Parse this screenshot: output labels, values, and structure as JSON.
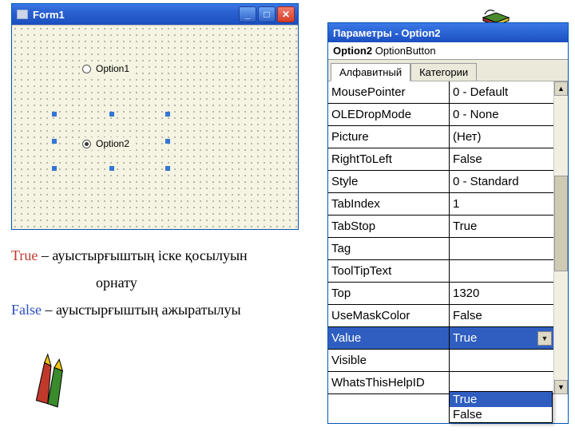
{
  "form": {
    "title": "Form1",
    "options": [
      {
        "label": "Option1",
        "checked": false
      },
      {
        "label": "Option2",
        "checked": true
      }
    ]
  },
  "caption": {
    "true_word": "True",
    "true_rest": " – ауыстырғыштың іске қосылуын",
    "line2": "орнату",
    "false_word": "False",
    "false_rest": " – ауыстырғыштың ажыратылуы"
  },
  "props": {
    "title": "Параметры - Option2",
    "object_bold": "Option2",
    "object_type": " OptionButton",
    "tabs": {
      "alpha": "Алфавитный",
      "cat": "Категории"
    },
    "rows": [
      {
        "k": "MousePointer",
        "v": "0 - Default"
      },
      {
        "k": "OLEDropMode",
        "v": "0 - None"
      },
      {
        "k": "Picture",
        "v": "(Нет)"
      },
      {
        "k": "RightToLeft",
        "v": "False"
      },
      {
        "k": "Style",
        "v": "0 - Standard"
      },
      {
        "k": "TabIndex",
        "v": "1"
      },
      {
        "k": "TabStop",
        "v": "True"
      },
      {
        "k": "Tag",
        "v": ""
      },
      {
        "k": "ToolTipText",
        "v": ""
      },
      {
        "k": "Top",
        "v": "1320"
      },
      {
        "k": "UseMaskColor",
        "v": "False"
      },
      {
        "k": "Value",
        "v": "True",
        "selected": true
      },
      {
        "k": "Visible",
        "v": ""
      },
      {
        "k": "WhatsThisHelpID",
        "v": ""
      }
    ],
    "dropdown": [
      "True",
      "False"
    ]
  }
}
